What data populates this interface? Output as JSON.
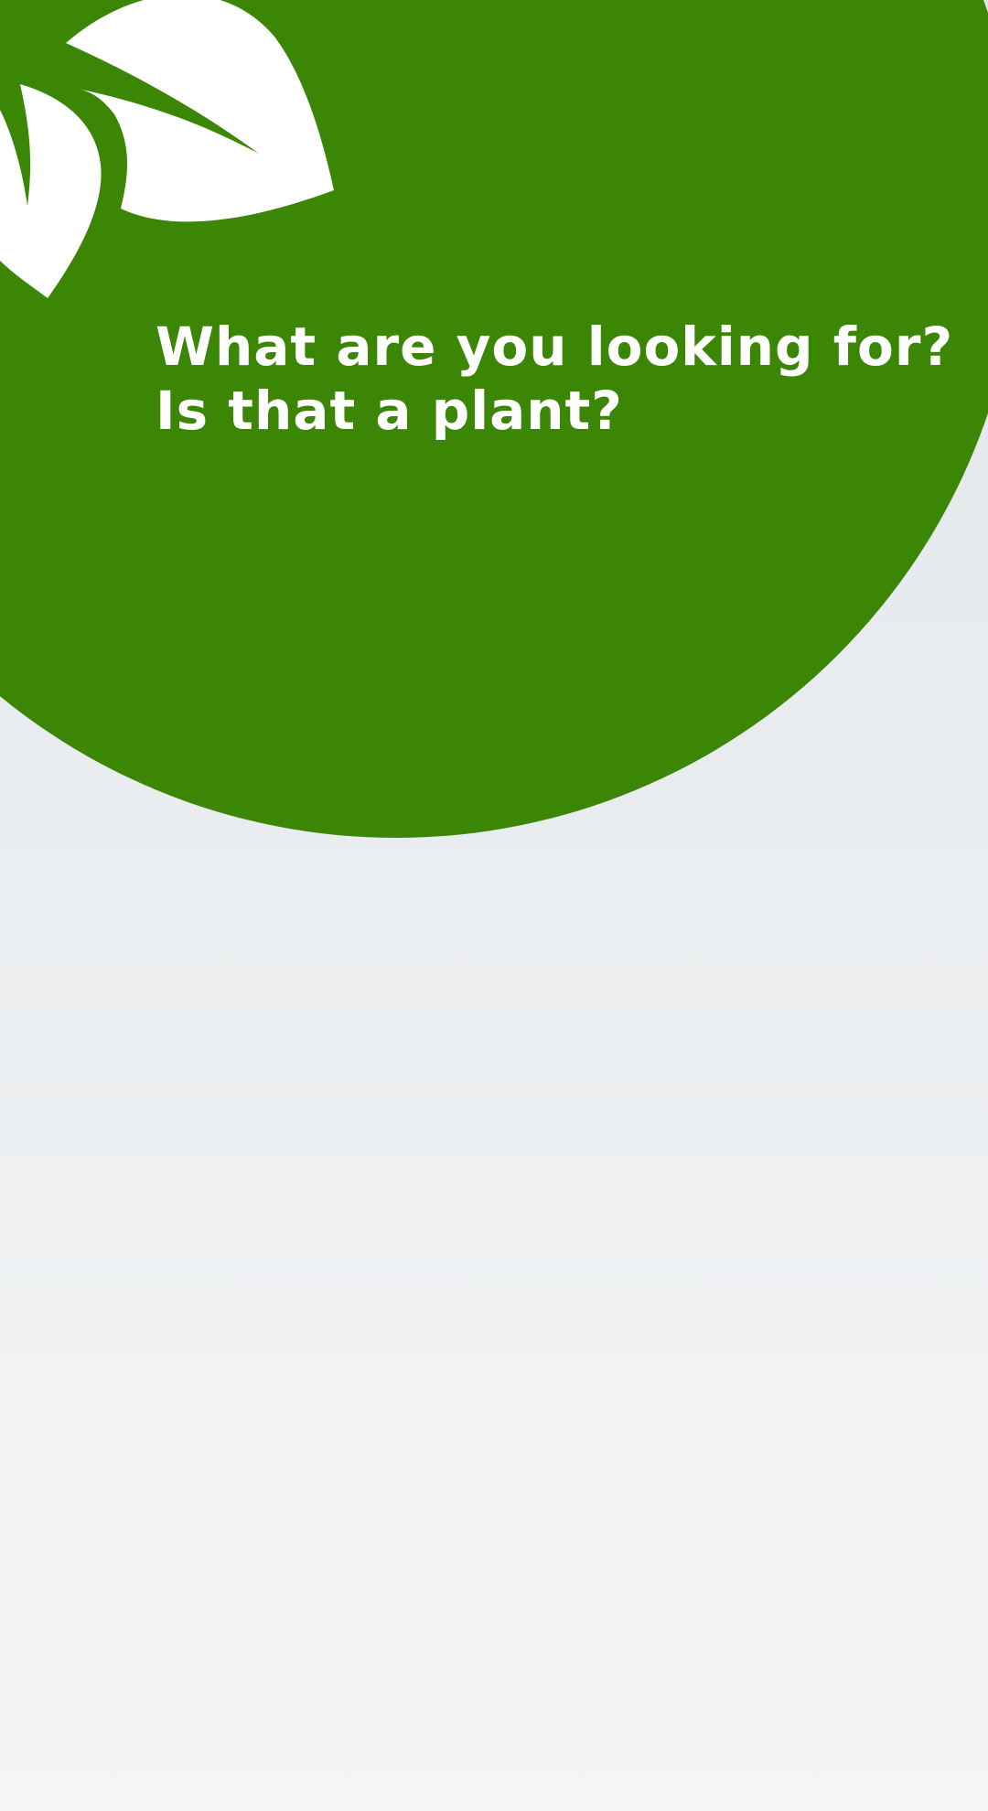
{
  "colors": {
    "brand_green": "#3b8705",
    "leaf_white": "#ffffff",
    "background_top": "#e2e6e9",
    "background_bottom": "#f4f5f7",
    "prompt_text": "#ffffff"
  },
  "header": {
    "logo_icon": "plant-leaves-icon"
  },
  "prompt": {
    "line1": "What are you looking for?",
    "line2": "Is that a plant?"
  }
}
